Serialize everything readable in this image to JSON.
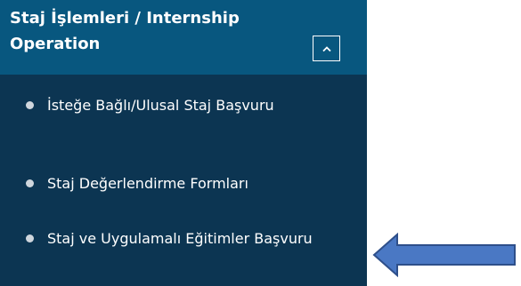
{
  "sidebar": {
    "section_title": "Staj İşlemleri / Internship Operation",
    "collapse_icon": "chevron-up-icon",
    "items": [
      {
        "label": "İsteğe Bağlı/Ulusal Staj Başvuru"
      },
      {
        "label": "Staj Değerlendirme Formları"
      },
      {
        "label": "Staj ve Uygulamalı Eğitimler Başvuru"
      }
    ]
  },
  "colors": {
    "header_bg": "#08577f",
    "sidebar_bg": "#0c3552",
    "arrow_fill": "#4a78c4",
    "arrow_stroke": "#2e4f8a"
  }
}
